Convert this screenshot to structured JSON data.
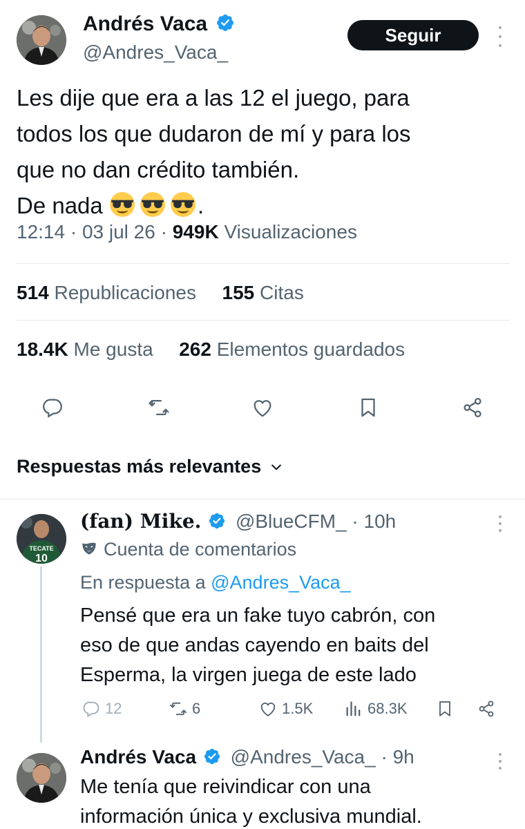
{
  "main_tweet": {
    "author_name": "Andrés Vaca",
    "author_handle": "@Andres_Vaca_",
    "follow_label": "Seguir",
    "text_lines": [
      "Les dije que era a las 12 el juego, para",
      "todos los que dudaron de mí y para los",
      "que no dan crédito también.",
      "De nada"
    ],
    "text_end": ".",
    "emoji_icon": "smiling-face-with-sunglasses",
    "emoji_count": 3,
    "time": "12:14",
    "date": "03 jul 26",
    "views_value": "949K",
    "views_label": "Visualizaciones",
    "reposts_value": "514",
    "reposts_label": "Republicaciones",
    "quotes_value": "155",
    "quotes_label": "Citas",
    "likes_value": "18.4K",
    "likes_label": "Me gusta",
    "bookmarks_value": "262",
    "bookmarks_label": "Elementos guardados",
    "action_icons": [
      "reply-icon",
      "repost-icon",
      "like-icon",
      "bookmark-icon",
      "share-icon"
    ]
  },
  "replies_header": "Respuestas más relevantes",
  "reply1": {
    "author_name": "(fan) Mike.",
    "author_handle": "@BlueCFM_",
    "time": "· 10h",
    "account_type": "Cuenta de comentarios",
    "in_reply_prefix": "En respuesta a ",
    "in_reply_handle": "@Andres_Vaca_",
    "text_lines": [
      "Pensé que era un fake tuyo cabrón, con",
      "eso de que andas cayendo en baits del",
      "Esperma, la virgen juega de este lado"
    ],
    "replies_count": "12",
    "reposts_count": "6",
    "likes_count": "1.5K",
    "views_count": "68.3K",
    "jersey_text": "TECATE",
    "jersey_number": "10"
  },
  "reply2": {
    "author_name": "Andrés Vaca",
    "author_handle": "@Andres_Vaca_",
    "time": "· 9h",
    "text_lines": [
      "Me tenía que reivindicar con una",
      "información única y exclusiva mundial."
    ]
  },
  "colors": {
    "text": "#0f1419",
    "secondary": "#536471",
    "verified": "#1d9bf0",
    "link": "#1d9bf0",
    "divider": "#e4e8eb"
  }
}
